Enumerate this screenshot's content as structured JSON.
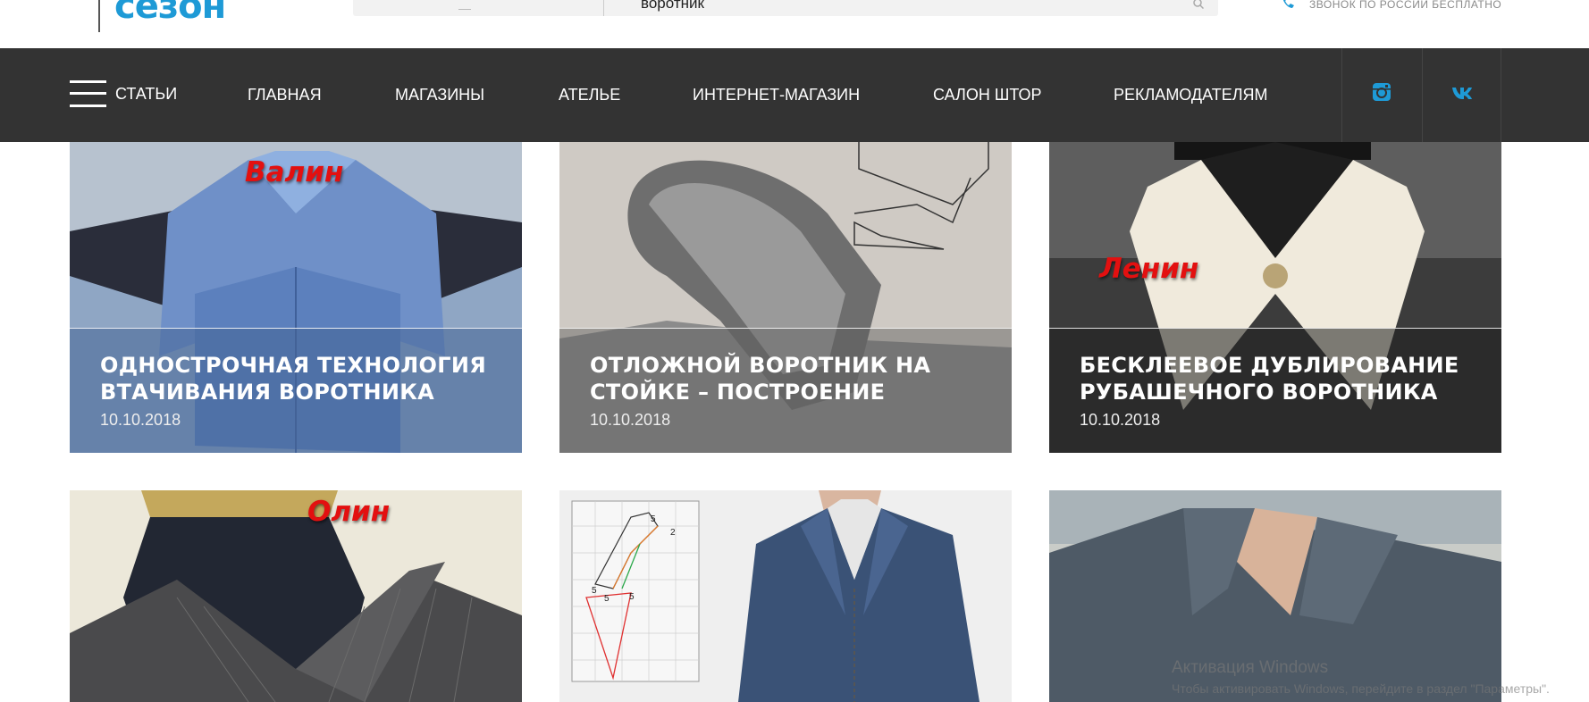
{
  "header": {
    "logo_text": "сезон",
    "search": {
      "value": "воротник"
    },
    "phone_caption": "ЗВОНОК ПО РОССИИ БЕСПЛАТНО"
  },
  "nav": {
    "menu_label": "СТАТЬИ",
    "items": [
      {
        "label": "ГЛАВНАЯ"
      },
      {
        "label": "МАГАЗИНЫ"
      },
      {
        "label": "АТЕЛЬЕ"
      },
      {
        "label": "ИНТЕРНЕТ-МАГАЗИН"
      },
      {
        "label": "САЛОН ШТОР"
      },
      {
        "label": "РЕКЛАМОДАТЕЛЯМ"
      }
    ],
    "social": [
      {
        "icon": "instagram-icon"
      },
      {
        "icon": "vk-icon"
      }
    ],
    "social_color": "#1e9ad6"
  },
  "articles": [
    {
      "title_line1": "ОДНОСТРОЧНАЯ ТЕХНОЛОГИЯ",
      "title_line2": "ВТАЧИВАНИЯ ВОРОТНИКА",
      "date": "10.10.2018",
      "stamp": "Валин"
    },
    {
      "title_line1": "ОТЛОЖНОЙ ВОРОТНИК НА",
      "title_line2": "СТОЙКЕ – ПОСТРОЕНИЕ",
      "date": "10.10.2018",
      "stamp": ""
    },
    {
      "title_line1": "БЕСКЛЕЕВОЕ ДУБЛИРОВАНИЕ",
      "title_line2": "РУБАШЕЧНОГО ВОРОТНИКА",
      "date": "10.10.2018",
      "stamp": "Ленин"
    },
    {
      "stamp": "Олин"
    },
    {
      "pattern_labels": [
        "5",
        "2",
        "5",
        "5",
        "5"
      ]
    },
    {}
  ],
  "watermark": {
    "title": "Активация Windows",
    "subtitle": "Чтобы активировать Windows, перейдите в раздел \"Параметры\"."
  },
  "colors": {
    "accent": "#1e9ad6",
    "nav_bg": "#333333",
    "stamp_red": "#e31010"
  }
}
